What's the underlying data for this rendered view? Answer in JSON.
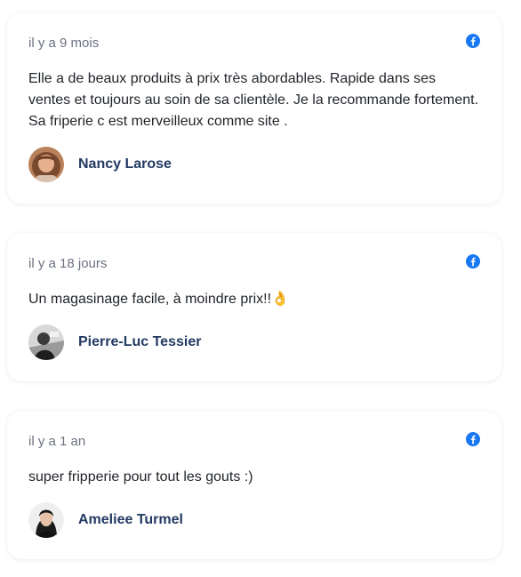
{
  "reviews": [
    {
      "time": "il y a 9 mois",
      "source_icon": "facebook-icon",
      "text": "Elle a de beaux produits à prix très abordables. Rapide dans ses ventes et toujours au soin de sa clientèle. Je la recommande fortement. Sa friperie c est merveilleux comme site .",
      "author": "Nancy Larose"
    },
    {
      "time": "il y a 18 jours",
      "source_icon": "facebook-icon",
      "text": "Un magasinage facile, à moindre prix!!👌",
      "author": "Pierre-Luc Tessier"
    },
    {
      "time": "il y a 1 an",
      "source_icon": "facebook-icon",
      "text": "super fripperie pour tout les gouts :)",
      "author": "Ameliee Turmel"
    }
  ],
  "colors": {
    "facebook": "#1877f2",
    "author_name": "#233a63",
    "time": "#6b7280",
    "text": "#1f2328"
  }
}
